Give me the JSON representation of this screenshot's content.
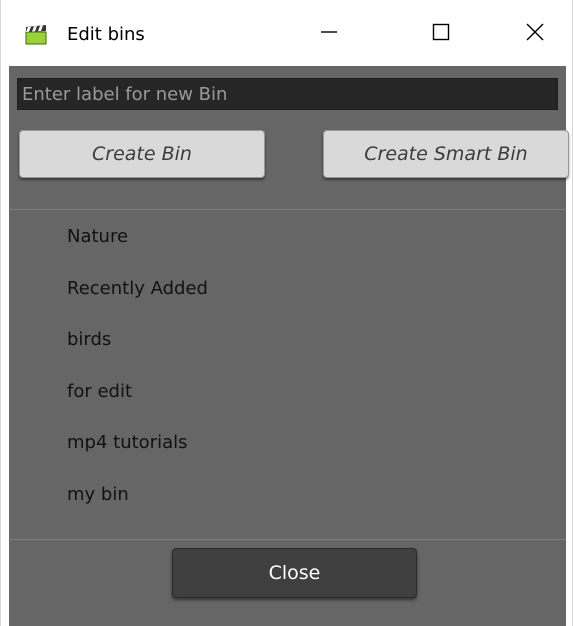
{
  "window": {
    "title": "Edit bins",
    "controls": [
      "minimize-icon",
      "maximize-icon",
      "close-icon"
    ],
    "app_icon": "clapperboard-icon"
  },
  "form": {
    "label_input_placeholder": "Enter label for new Bin",
    "label_input_value": "",
    "create_bin_label": "Create Bin",
    "create_smart_bin_label": "Create Smart Bin"
  },
  "bins": [
    {
      "label": "Nature"
    },
    {
      "label": "Recently Added"
    },
    {
      "label": "birds"
    },
    {
      "label": "for edit"
    },
    {
      "label": "mp4 tutorials"
    },
    {
      "label": "my bin"
    }
  ],
  "footer": {
    "close_label": "Close"
  },
  "colors": {
    "panel_bg": "#666666",
    "input_bg": "#262626",
    "button_light": "#d9d9d9",
    "button_dark": "#3f3f3f"
  }
}
